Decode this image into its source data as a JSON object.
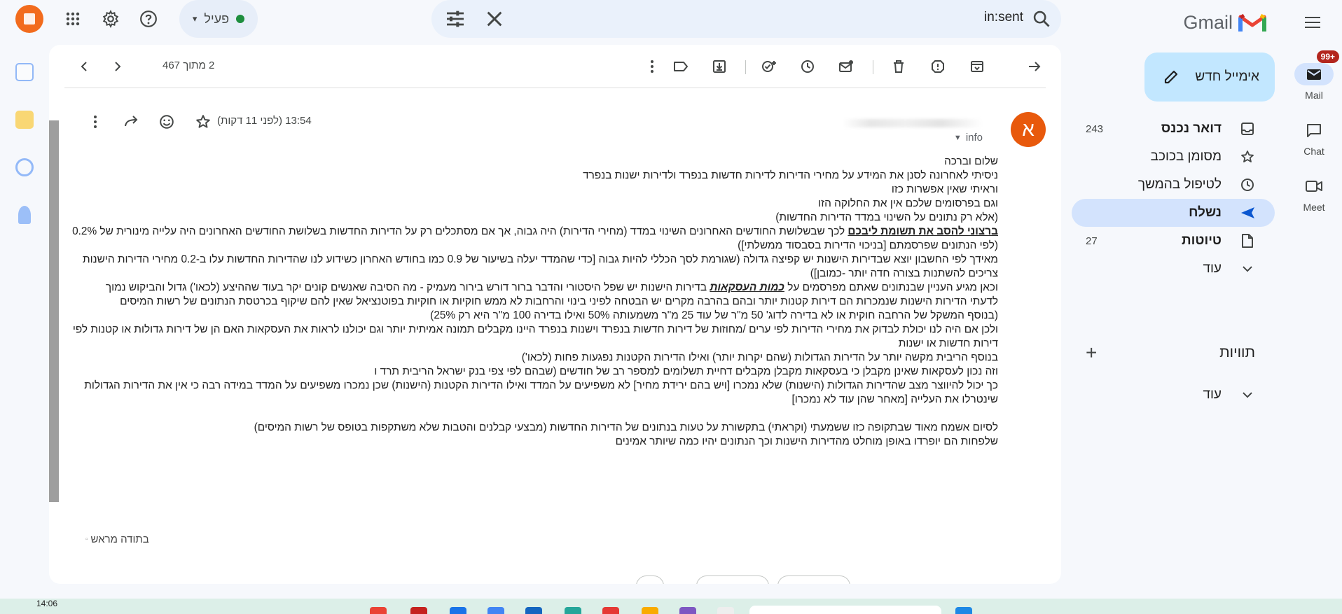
{
  "app": {
    "name": "Gmail"
  },
  "search": {
    "query": "in:sent"
  },
  "status": {
    "label": "פעיל"
  },
  "compose": {
    "label": "אימייל חדש"
  },
  "nav": {
    "items": [
      {
        "label": "דואר נכנס",
        "count": "243",
        "icon": "inbox-icon"
      },
      {
        "label": "מסומן בכוכב",
        "count": "",
        "icon": "star-icon"
      },
      {
        "label": "לטיפול בהמשך",
        "count": "",
        "icon": "clock-icon"
      },
      {
        "label": "נשלח",
        "count": "",
        "icon": "send-icon"
      },
      {
        "label": "טיוטות",
        "count": "27",
        "icon": "draft-icon"
      },
      {
        "label": "עוד",
        "count": "",
        "icon": "chevron-down-icon"
      }
    ],
    "labels_header": "תוויות",
    "labels_more": "עוד"
  },
  "apps": {
    "mail": {
      "label": "Mail",
      "badge": "99+"
    },
    "chat": {
      "label": "Chat"
    },
    "meet": {
      "label": "Meet"
    }
  },
  "toolbar": {
    "pager": "2 מתוך 467"
  },
  "message": {
    "avatar_letter": "א",
    "to": "info",
    "time": "13:54 (לפני 11 דקות)",
    "lines": [
      "שלום וברכה",
      "ניסיתי לאחרונה לסנן את המידע על מחירי הדירות לדירות חדשות בנפרד ולדירות ישנות בנפרד",
      "וראיתי שאין אפשרות כזו",
      "וגם בפרסומים שלכם אין את החלוקה הזו",
      "(אלא רק נתונים על השינוי במדד הדירות החדשות)",
      {
        "pre": "",
        "em": "ברצוני להסב את תשומת ליבכם",
        "post": " לכך שבשלושת החודשים האחרונים השינוי במדד (מחירי הדירות) היה גבוה, אך אם מסתכלים רק על הדירות החדשות בשלושת החודשים האחרונים היה עלייה מינורית של 0.2%"
      },
      "(לפי הנתונים שפרסמתם [בניכוי הדירות בסבסוד ממשלתי])",
      "מאידך לפי החשבון יוצא שבדירות הישנות יש קפיצה גדולה (שגורמת לסך הכללי להיות גבוה [כדי שהמדד יעלה בשיעור של 0.9 כמו בחודש האחרון כשידוע לנו שהדירות החדשות עלו ב-0.2 מחירי הדירות הישנות צריכים להשתנות בצורה חדה יותר -כמובן])",
      {
        "pre": "וכאן מגיע העניין שבנתונים שאתם מפרסמים על ",
        "em2": "כמות העסקאות",
        "post": " בדירות הישנות יש שפל היסטורי והדבר ברור דורש בירור מעמיק - מה הסיבה שאנשים קונים יקר בעוד שההיצע (לכאו') גדול והביקוש נמוך"
      },
      "לדעתי הדירות הישנות שנמכרות הם דירות קטנות יותר ובהם בהרבה מקרים יש הבטחה לפיני בינוי והרחבות לא ממש חוקיות או חוקיות בפוטנציאל שאין להם שיקוף בכרטסת הנתונים של רשות המיסים",
      "(בנוסף המשקל של הרחבה חוקית או לא  בדירה לדוג' 50 מ\"ר של עוד 25 מ\"ר משמעותה 50% ואילו בדירה 100 מ\"ר היא רק 25%)",
      "ולכן אם היה  לנו יכולת לבדוק את מחירי הדירות לפי ערים /מחוזות של דירות חדשות בנפרד וישנות בנפרד היינו מקבלים תמונה אמיתית יותר וגם יכולנו לראות את העסקאות האם הן של דירות גדולות או קטנות לפי דירות חדשות או ישנות",
      "בנוסף הריבית מקשה יותר על הדירות הגדולות (שהם יקרות יותר) ואילו הדירות הקטנות נפגעות פחות (לכאו')",
      "וזה נכון לעסקאות שאינן מקבלן כי בעסקאות מקבלן מקבלים דחיית תשלומים למספר רב של חודשים (שבהם לפי צפי בנק ישראל הריבית תרד ו",
      "כך יכול להיווצר מצב שהדירות הגדולות (הישנות) שלא נמכרו [ויש בהם ירידת מחיר] לא משפיעים על המדד ואילו הדירות הקטנות (הישנות) שכן נמכרו משפיעים על המדד במידה רבה כי אין את הדירות הגדולות שינטרלו את העלייה [מאחר שהן עוד לא נמכרו]",
      "",
      "לסיום אשמח מאוד שבתקופה כזו ששמעתי (וקראתי) בתקשורת על טעות בנתונים של הדירות החדשות (מבצעי קבלנים והטבות שלא משתקפות בטופס של רשות המיסים)",
      "שלפחות הם יופרדו באופן מוחלט מהדירות הישנות וכך הנתונים יהיו כמה שיותר אמינים"
    ],
    "signature": "בתודה מראש"
  },
  "taskbar": {
    "time": "14:06"
  },
  "colors": {
    "accent": "#0b57d0",
    "compose": "#c2e7ff",
    "active_nav": "#d3e3fd",
    "avatar": "#e8590c",
    "badge": "#b3261e",
    "status_dot": "#1e8e3e"
  }
}
